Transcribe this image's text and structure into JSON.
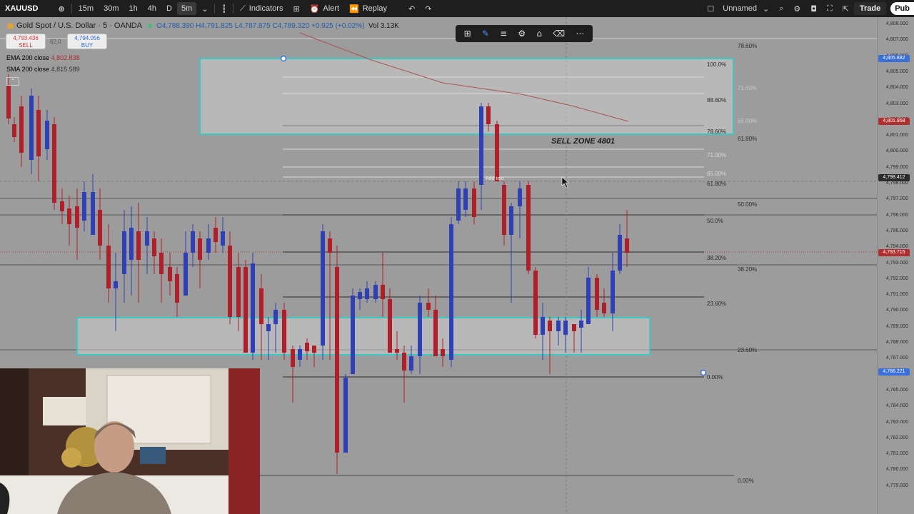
{
  "toolbar": {
    "symbol": "XAUUSD",
    "timeframes": [
      "15m",
      "30m",
      "1h",
      "4h",
      "D",
      "5m"
    ],
    "active_timeframe": "5m",
    "indicators_label": "Indicators",
    "alert_label": "Alert",
    "replay_label": "Replay",
    "layout_name": "Unnamed",
    "trade_label": "Trade",
    "publish_label": "Pub"
  },
  "legend": {
    "title": "Gold Spot / U.S. Dollar · 5 · OANDA",
    "open": "O4,788.390",
    "high": "H4,791.825",
    "low": "L4,787.875",
    "close": "C4,789.320",
    "change": "+0.925 (+0.02%)",
    "volume": "Vol 3.13K",
    "sell_price": "4,793.436",
    "sell_label": "SELL",
    "spread": "62.0",
    "buy_price": "4,794.056",
    "buy_label": "BUY",
    "ema_label": "EMA 200 close",
    "ema_value": "4,802.838",
    "sma_label": "SMA 200 close",
    "sma_value": "4,815.589"
  },
  "annotation": {
    "sell_zone": "SELL ZONE 4801",
    "add_text": "Add text"
  },
  "fib_labels_outer": [
    "78.60%",
    "71.00%",
    "65.00%",
    "61.80%",
    "50.00%",
    "38.20%",
    "23.60%",
    "0.00%"
  ],
  "fib_labels_inner": [
    "100.0%",
    "88.60%",
    "78.60%",
    "71.00%",
    "65.00%",
    "61.80%",
    "50.0%",
    "38.20%",
    "23.60%",
    "0.00%"
  ],
  "price_axis": {
    "ticks": [
      "4,808.000",
      "4,807.000",
      "4,806.000",
      "4,805.000",
      "4,804.000",
      "4,803.000",
      "4,802.000",
      "4,801.000",
      "4,800.000",
      "4,799.000",
      "4,798.000",
      "4,797.000",
      "4,796.000",
      "4,795.000",
      "4,794.000",
      "4,793.000",
      "4,792.000",
      "4,791.000",
      "4,790.000",
      "4,789.000",
      "4,788.000",
      "4,787.000",
      "4,786.000",
      "4,785.000",
      "4,784.000",
      "4,783.000",
      "4,782.000",
      "4,781.000",
      "4,780.000",
      "4,779.000"
    ],
    "tag_top": "4,805.882",
    "tag_ema": "4,801.958",
    "tag_cursor": "4,798.412",
    "tag_last": "4,793.715",
    "tag_bottom": "4,786.221"
  },
  "colors": {
    "bull": "#2f3fb8",
    "bear": "#b01e2a",
    "zone_border": "#3fc7c2",
    "ema": "#a85555"
  },
  "icons": {
    "drawbar": [
      "templates-icon",
      "pencil-icon",
      "lines-icon",
      "settings-icon",
      "lock-icon",
      "trash-icon",
      "more-icon"
    ]
  }
}
